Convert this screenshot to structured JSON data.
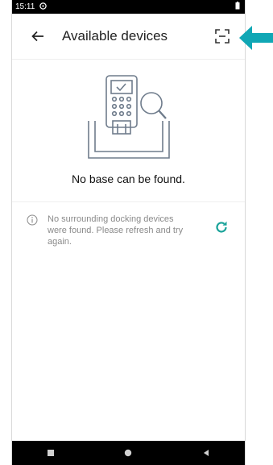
{
  "status_bar": {
    "time": "15:11"
  },
  "header": {
    "title": "Available devices"
  },
  "empty_state": {
    "message": "No base can be found."
  },
  "info": {
    "message": "No surrounding docking devices were found. Please refresh and try again."
  },
  "colors": {
    "accent": "#1aa39a",
    "arrow": "#10a7b5",
    "illustration": "#6f7c8c"
  },
  "icons": {
    "back": "back-arrow-icon",
    "scan": "scan-icon",
    "info": "info-icon",
    "refresh": "refresh-icon",
    "nav": [
      "square-recent-icon",
      "circle-home-icon",
      "triangle-back-icon"
    ]
  }
}
